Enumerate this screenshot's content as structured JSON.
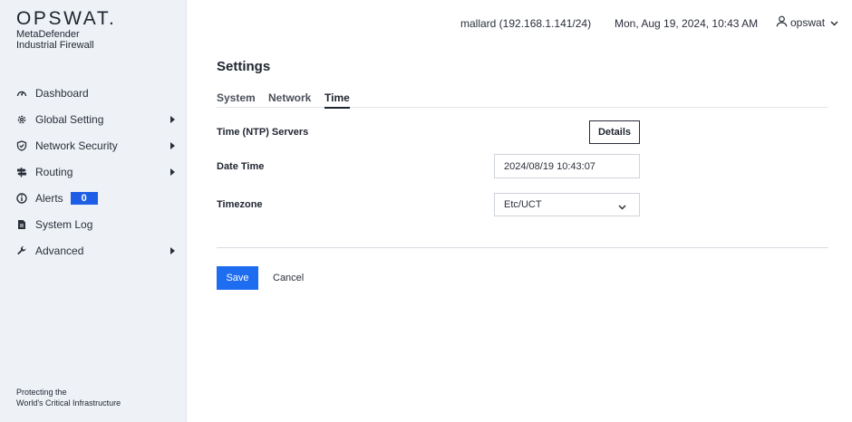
{
  "brand": {
    "logo": "OPSWAT.",
    "product_line1": "MetaDefender",
    "product_line2": "Industrial Firewall",
    "footer_line1": "Protecting the",
    "footer_line2": "World's Critical Infrastructure"
  },
  "sidebar": {
    "items": [
      {
        "label": "Dashboard",
        "icon": "dashboard-gauge-icon",
        "submenu": false
      },
      {
        "label": "Global Setting",
        "icon": "gear-icon",
        "submenu": true
      },
      {
        "label": "Network Security",
        "icon": "shield-check-icon",
        "submenu": true
      },
      {
        "label": "Routing",
        "icon": "signpost-icon",
        "submenu": true
      },
      {
        "label": "Alerts",
        "icon": "info-circle-icon",
        "submenu": false,
        "badge": "0"
      },
      {
        "label": "System Log",
        "icon": "document-icon",
        "submenu": false
      },
      {
        "label": "Advanced",
        "icon": "wrench-icon",
        "submenu": true
      }
    ]
  },
  "header": {
    "host": "mallard (192.168.1.141/24)",
    "datetime": "Mon, Aug 19, 2024, 10:43 AM",
    "user": "opswat"
  },
  "main": {
    "title": "Settings",
    "tabs": [
      {
        "label": "System",
        "active": false
      },
      {
        "label": "Network",
        "active": false
      },
      {
        "label": "Time",
        "active": true
      }
    ],
    "ntp_label": "Time (NTP) Servers",
    "details_label": "Details",
    "datetime_label": "Date Time",
    "datetime_value": "2024/08/19 10:43:07",
    "timezone_label": "Timezone",
    "timezone_value": "Etc/UCT",
    "save_label": "Save",
    "cancel_label": "Cancel"
  },
  "colors": {
    "accent": "#1e6cf0",
    "badge": "#1e5ee6",
    "sidebar_bg": "#eef1f6"
  }
}
